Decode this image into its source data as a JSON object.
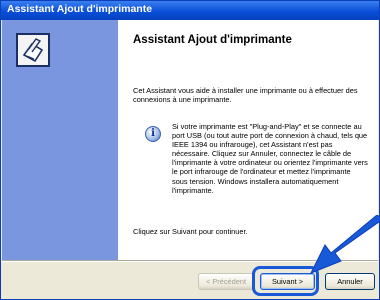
{
  "window": {
    "title": "Assistant Ajout d'imprimante"
  },
  "content": {
    "heading": "Assistant Ajout d'imprimante",
    "intro": "Cet Assistant vous aide à installer une imprimante ou à effectuer des connexions à une imprimante.",
    "note": "Si votre imprimante est \"Plug-and-Play\" et se connecte au port USB (ou tout autre port de connexion à chaud, tels que IEEE 1394 ou infrarouge), cet Assistant n'est pas nécessaire. Cliquez sur Annuler, connectez le câble de l'imprimante à votre ordinateur ou orientez l'imprimante vers le port infrarouge de l'ordinateur et mettez l'imprimante sous tension. Windows installera automatiquement l'imprimante.",
    "cta": "Cliquez sur Suivant pour continuer."
  },
  "icons": {
    "wizard": "printer-wizard-icon",
    "info": "info-icon",
    "arrow": "pointer-arrow-icon"
  },
  "buttons": {
    "prev": "< Précédent",
    "next": "Suivant >",
    "cancel": "Annuler"
  },
  "colors": {
    "titlebar": "#0a4fd8",
    "left_panel": "#7a96df",
    "highlight": "#1759d6"
  }
}
